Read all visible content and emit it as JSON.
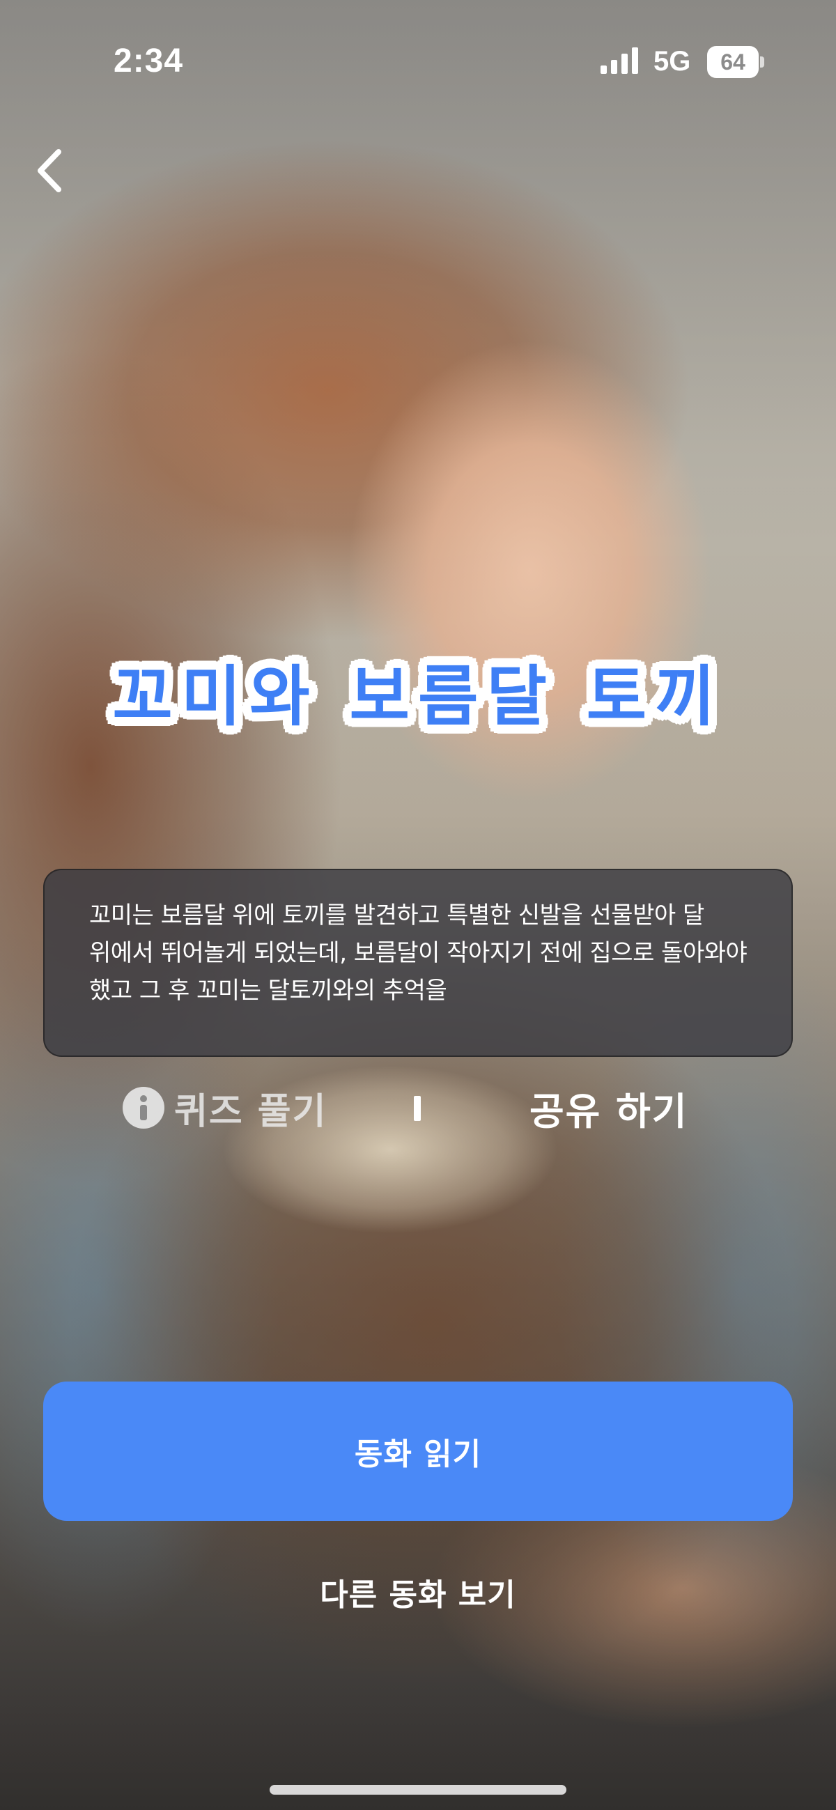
{
  "status_bar": {
    "time": "2:34",
    "network": "5G",
    "battery": "64"
  },
  "header": {
    "back_icon": "chevron-left-icon"
  },
  "story": {
    "title": "꼬미와 보름달 토끼",
    "summary": "꼬미는 보름달 위에 토끼를 발견하고 특별한 신발을 선물받아 달 위에서 뛰어놀게 되었는데, 보름달이 작아지기 전에 집으로 돌아와야 했고 그 후 꼬미는 달토끼와의 추억을"
  },
  "actions": {
    "quiz_label": "퀴즈 풀기",
    "quiz_icon": "info-icon",
    "share_label": "공유 하기"
  },
  "buttons": {
    "read_label": "동화 읽기",
    "other_label": "다른 동화 보기"
  },
  "colors": {
    "accent": "#4a89f7",
    "title": "#3e7ff5",
    "card_bg": "#3c3c42"
  }
}
